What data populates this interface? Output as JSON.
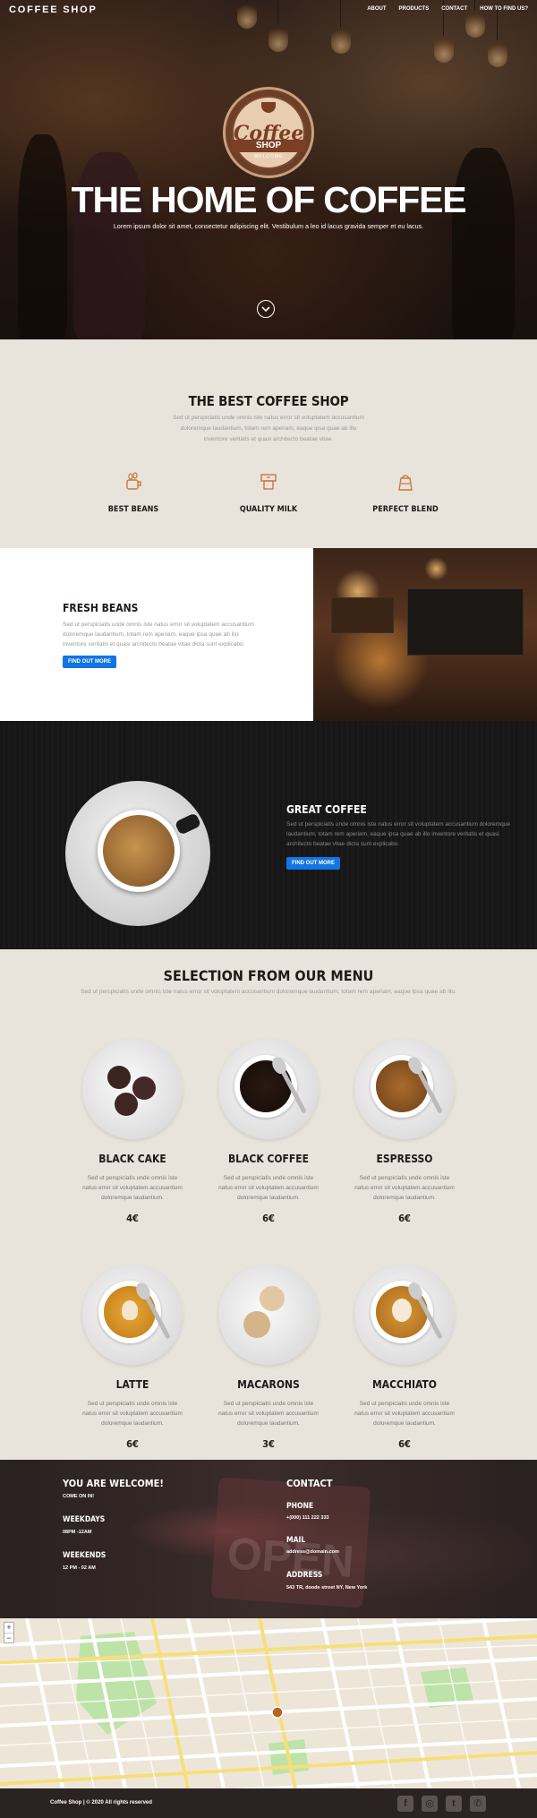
{
  "nav": {
    "brand": "COFFEE SHOP",
    "links": [
      "ABOUT",
      "PRODUCTS",
      "CONTACT",
      "HOW TO FIND US?"
    ]
  },
  "hero": {
    "logo_top": "Coffee",
    "logo_mid": "SHOP",
    "logo_bottom": "WELCOME",
    "title": "THE HOME OF COFFEE",
    "subtitle": "Lorem ipsum dolor sit amet, consectetur adipiscing elit. Vestibulum a leo id lacus gravida semper et eu lacus."
  },
  "best": {
    "title": "THE BEST COFFEE SHOP",
    "text": "Sed ut perspiciatis unde omnis iste natus error sit voluptatem accusantium doloremque laudantium, totam rem aperiam, eaque ipsa quae ab illo inventore veritatis et quasi architecto beatae vitae.",
    "features": [
      {
        "label": "BEST BEANS",
        "icon": "coffee-beans-icon"
      },
      {
        "label": "QUALITY MILK",
        "icon": "milk-icon"
      },
      {
        "label": "PERFECT BLEND",
        "icon": "blend-jar-icon"
      }
    ]
  },
  "fresh": {
    "title": "FRESH BEANS",
    "text": "Sed ut perspiciatis unde omnis iste natus error sit voluptatem accusantium doloremque laudantium, totam rem aperiam, eaque ipsa quae ab illo inventore veritatis et quasi architecto beatae vitae dicta sunt explicabo.",
    "button": "FIND OUT MORE"
  },
  "great": {
    "title": "GREAT COFFEE",
    "text": "Sed ut perspiciatis unde omnis iste natus error sit voluptatem accusantium doloremque laudantium, totam rem aperiam, eaque ipsa quae ab illo inventore veritatis et quasi architecto beatae vitae dicta sunt explicabo.",
    "button": "FIND OUT MORE"
  },
  "menu": {
    "title": "SELECTION FROM OUR MENU",
    "subtitle": "Sed ut perspiciatis unde omnis iste natus error sit voluptatem accusantium doloremque laudantium, totam rem aperiam, eaque ipsa quae ab illo.",
    "items": [
      {
        "name": "BLACK CAKE",
        "desc": "Sed ut perspiciatis unde omnis iste natus error sit voluptatem accusantium doloremque laudantium.",
        "price": "4€"
      },
      {
        "name": "BLACK COFFEE",
        "desc": "Sed ut perspiciatis unde omnis iste natus error sit voluptatem accusantium doloremque laudantium.",
        "price": "6€"
      },
      {
        "name": "ESPRESSO",
        "desc": "Sed ut perspiciatis unde omnis iste natus error sit voluptatem accusantium doloremque laudantium.",
        "price": "6€"
      },
      {
        "name": "LATTE",
        "desc": "Sed ut perspiciatis unde omnis iste natus error sit voluptatem accusantium doloremque laudantium.",
        "price": "6€"
      },
      {
        "name": "MACARONS",
        "desc": "Sed ut perspiciatis unde omnis iste natus error sit voluptatem accusantium doloremque laudantium.",
        "price": "3€"
      },
      {
        "name": "MACCHIATO",
        "desc": "Sed ut perspiciatis unde omnis iste natus error sit voluptatem accusantium doloremque laudantium.",
        "price": "6€"
      }
    ]
  },
  "welcome": {
    "title": "YOU ARE WELCOME!",
    "come": "COME ON IN!",
    "weekdays_label": "WEEKDAYS",
    "weekdays_hours": "08PM -12AM",
    "weekends_label": "WEEKENDS",
    "weekends_hours": "12 PM - 02 AM",
    "contact_title": "CONTACT",
    "phone_label": "PHONE",
    "phone": "+(000) 111 222 333",
    "mail_label": "MAIL",
    "mail": "address@domain.com",
    "address_label": "ADDRESS",
    "address": "543 TR, doode street NY, New York"
  },
  "map": {
    "zoom_in": "+",
    "zoom_out": "−"
  },
  "footer": {
    "copyright": "Coffee Shop | © 2020 All rights reserved",
    "social": [
      {
        "icon": "facebook-icon",
        "glyph": "f"
      },
      {
        "icon": "instagram-icon",
        "glyph": "◎"
      },
      {
        "icon": "twitter-icon",
        "glyph": "t"
      },
      {
        "icon": "whatsapp-icon",
        "glyph": "✆"
      }
    ]
  },
  "colors": {
    "accent": "#1275e4",
    "dark": "#2a2322",
    "cream": "#e8e4dc",
    "brown": "#c9783f"
  }
}
